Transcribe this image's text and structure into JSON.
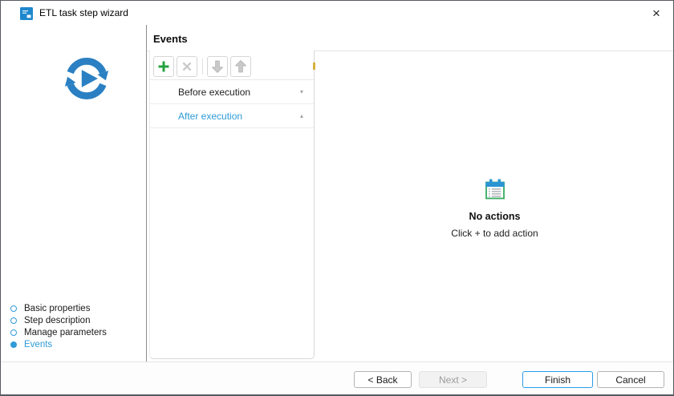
{
  "window": {
    "title": "ETL task step wizard",
    "close_glyph": "×"
  },
  "sidebar": {
    "steps": [
      {
        "label": "Basic properties",
        "active": false
      },
      {
        "label": "Step description",
        "active": false
      },
      {
        "label": "Manage parameters",
        "active": false
      },
      {
        "label": "Events",
        "active": true
      }
    ]
  },
  "content": {
    "header": "Events",
    "toolbar": [
      {
        "name": "add",
        "icon": "plus-icon",
        "enabled": true
      },
      {
        "name": "delete",
        "icon": "cross-icon",
        "enabled": false
      },
      {
        "name": "move-down",
        "icon": "arrow-down-icon",
        "enabled": false
      },
      {
        "name": "move-up",
        "icon": "arrow-up-icon",
        "enabled": false
      }
    ],
    "events": [
      {
        "label": "Before execution",
        "indicator": "▾",
        "selected": false
      },
      {
        "label": "After execution",
        "indicator": "▴",
        "selected": true
      }
    ],
    "empty_state": {
      "icon": "actions-list-icon",
      "title": "No actions",
      "hint": "Click + to add action"
    }
  },
  "footer": {
    "buttons": [
      {
        "label": "< Back",
        "role": "back",
        "enabled": true
      },
      {
        "label": "Next >",
        "role": "next",
        "enabled": false
      },
      {
        "label": "Finish",
        "role": "finish",
        "enabled": true,
        "default": true
      },
      {
        "label": "Cancel",
        "role": "cancel",
        "enabled": true
      }
    ]
  },
  "colors": {
    "accent_blue": "#2e9bd6",
    "logo_blue": "#2a80c2",
    "add_green": "#23a33f",
    "finish_border_blue": "#2b9ce8",
    "disabled_gray": "#c9c9c9",
    "marker_yellow": "#d7b13c"
  }
}
